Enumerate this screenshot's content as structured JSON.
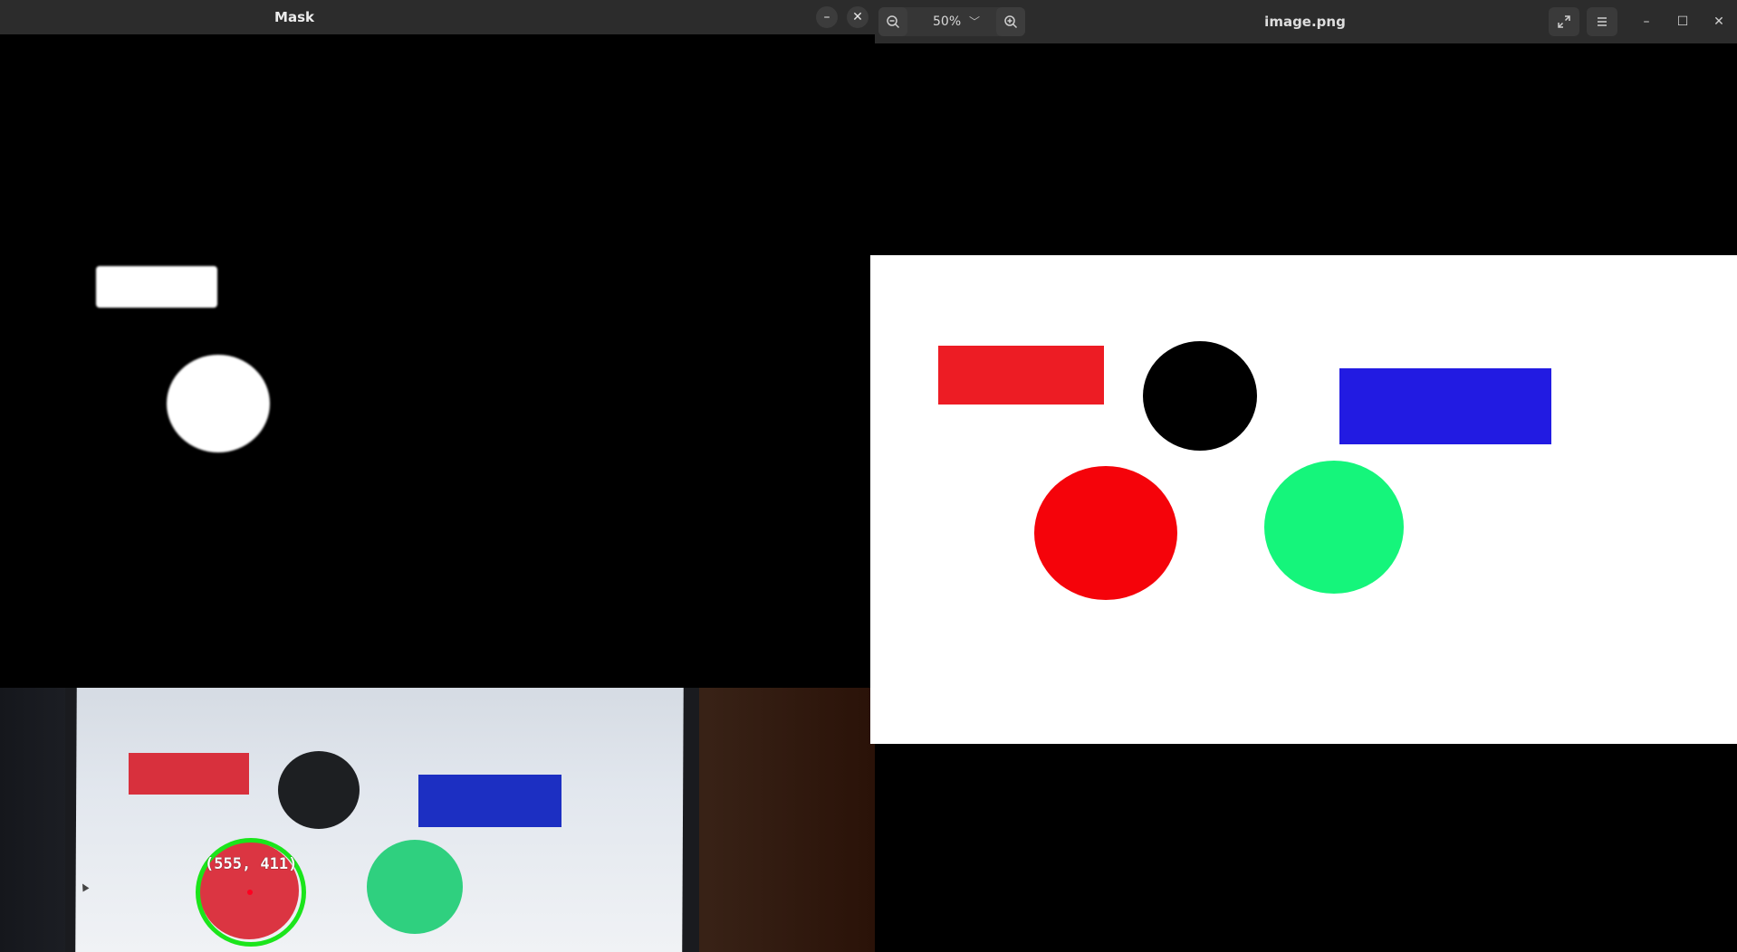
{
  "mask_window": {
    "title": "Mask",
    "minimize_label": "–",
    "close_label": "✕",
    "minimize_icon": "minimize-icon",
    "close_icon": "close-icon"
  },
  "camera_feed": {
    "detection_label": "(555, 411)",
    "colors": {
      "detection_ring": "#1be51b",
      "center_dot": "#ff0020"
    }
  },
  "viewer": {
    "title": "image.png",
    "zoom_level": "50%",
    "zoom_dropdown": "﹀",
    "icons": {
      "zoom_out": "zoom-out-icon",
      "zoom_in": "zoom-in-icon",
      "fullscreen": "fullscreen-icon",
      "menu": "hamburger-menu-icon",
      "minimize": "minimize-icon",
      "maximize": "maximize-icon",
      "close": "close-icon"
    },
    "minimize_label": "–",
    "maximize_label": "☐",
    "close_label": "✕",
    "image_colors": {
      "red_rect": "#ed1c24",
      "black_circle": "#000000",
      "blue_rect": "#221be2",
      "red_circle": "#f5030a",
      "green_circle": "#15f57b"
    }
  }
}
